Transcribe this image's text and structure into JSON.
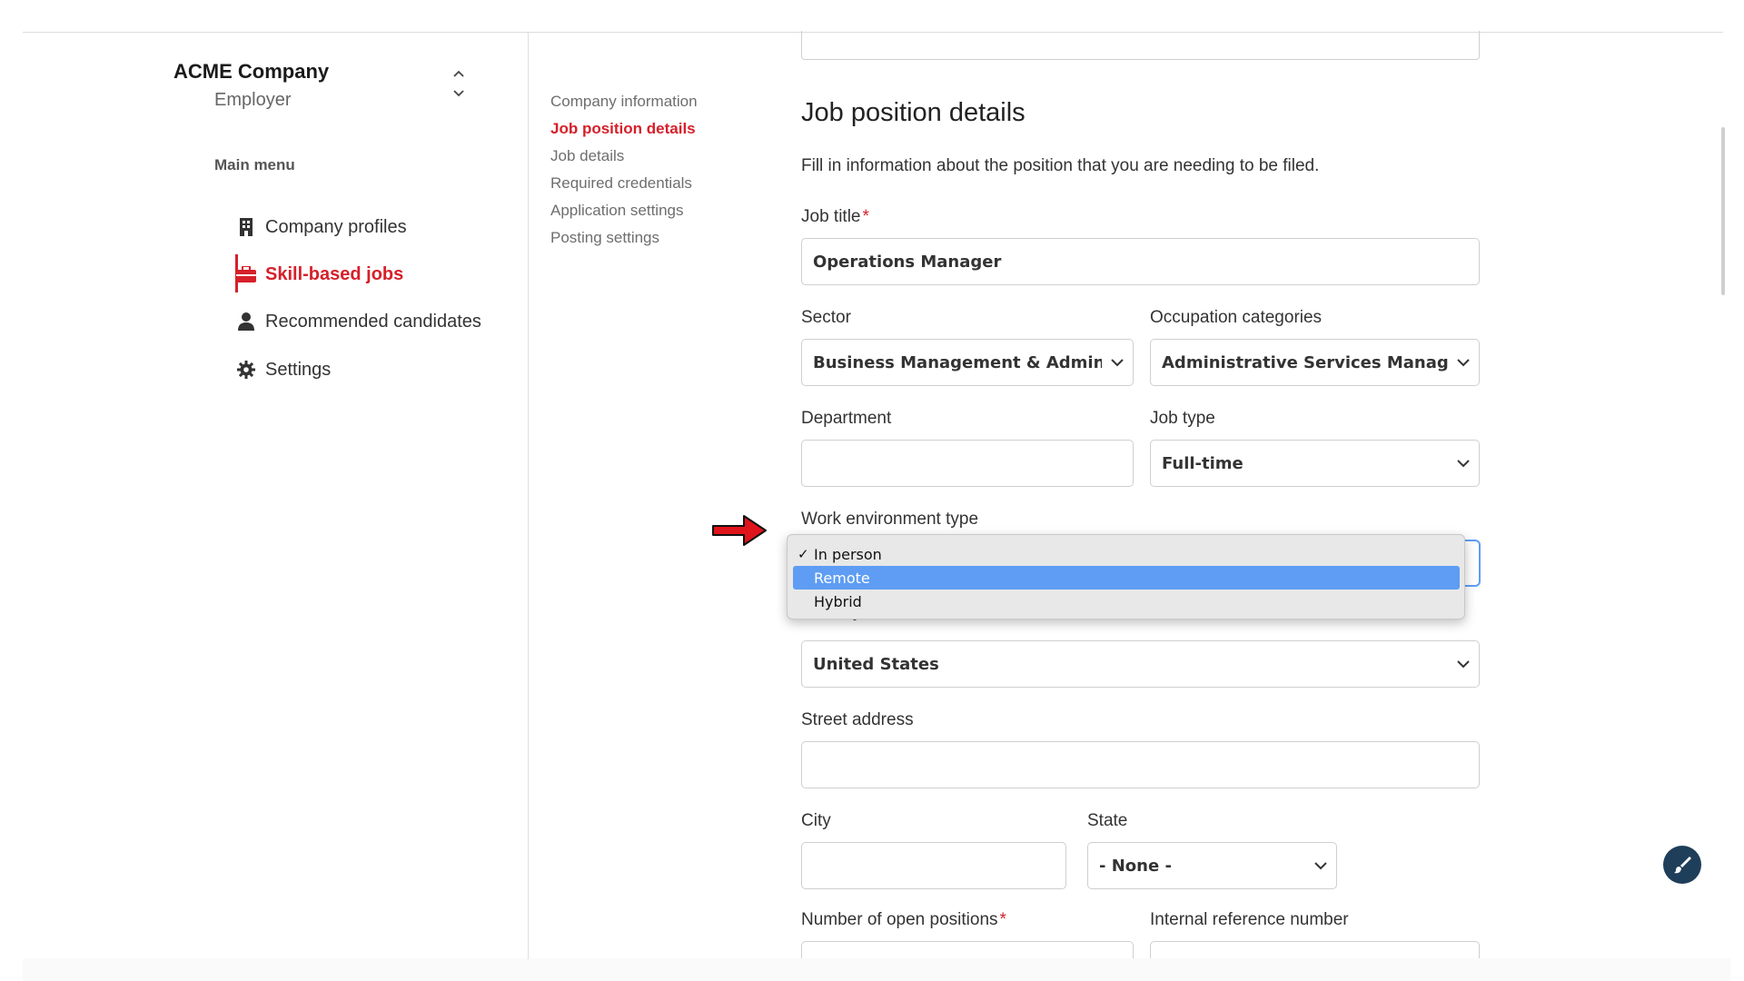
{
  "sidebar": {
    "company_name": "ACME Company",
    "company_role": "Employer",
    "menu_heading": "Main menu",
    "items": [
      {
        "label": "Company profiles",
        "icon": "building-icon"
      },
      {
        "label": "Skill-based jobs",
        "icon": "briefcase-icon",
        "active": true
      },
      {
        "label": "Recommended candidates",
        "icon": "person-icon"
      },
      {
        "label": "Settings",
        "icon": "gear-icon"
      }
    ]
  },
  "subnav": [
    "Company information",
    "Job position details",
    "Job details",
    "Required credentials",
    "Application settings",
    "Posting settings"
  ],
  "form": {
    "title": "Job position details",
    "description": "Fill in information about the position that you are needing to be filed.",
    "job_title": {
      "label": "Job title",
      "value": "Operations Manager"
    },
    "sector": {
      "label": "Sector",
      "value": "Business Management & Administra"
    },
    "occupation": {
      "label": "Occupation categories",
      "value": "Administrative Services Managers"
    },
    "department": {
      "label": "Department",
      "value": ""
    },
    "job_type": {
      "label": "Job type",
      "value": "Full-time"
    },
    "work_env": {
      "label": "Work environment type",
      "options": [
        "In person",
        "Remote",
        "Hybrid"
      ],
      "selected": "In person",
      "highlighted": "Remote",
      "check_mark": "✓"
    },
    "country": {
      "label": "Country",
      "value": "United States"
    },
    "street": {
      "label": "Street address",
      "value": ""
    },
    "city": {
      "label": "City",
      "value": ""
    },
    "state": {
      "label": "State",
      "value": "- None -"
    },
    "open_positions": {
      "label": "Number of open positions"
    },
    "internal_ref": {
      "label": "Internal reference number"
    },
    "required_mark": "*"
  },
  "colors": {
    "accent": "#d6202a",
    "highlight": "#5e9df3",
    "fab": "#1f3e5a"
  }
}
